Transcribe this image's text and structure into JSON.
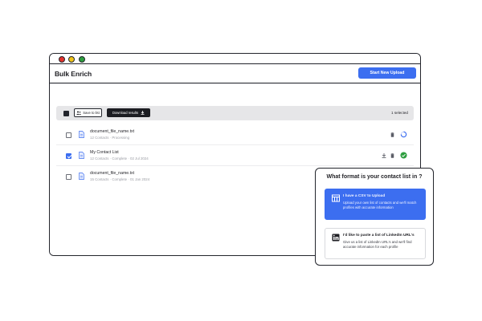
{
  "window": {
    "controls": [
      "close",
      "minimize",
      "maximize"
    ]
  },
  "app": {
    "title": "Bulk Enrich",
    "new_upload_label": "Start New Upload",
    "accent": "#3c6ef0"
  },
  "toolbar": {
    "save_label": "Save to list",
    "download_label": "Download results",
    "selected_text": "1 selected"
  },
  "files": [
    {
      "name": "document_file_name.txt",
      "meta": "12 Contacts  ·  Processing",
      "checked": false,
      "status": "processing"
    },
    {
      "name": "My Contact List",
      "meta": "12 Contacts  ·  Complete  ·  02 Jul 2024",
      "checked": true,
      "status": "complete"
    },
    {
      "name": "document_file_name.txt",
      "meta": "15 Contacts  ·  Complete  ·  01 Jan 2024",
      "checked": false,
      "status": "complete"
    }
  ],
  "popup": {
    "title": "What format is your contact list in ?",
    "options": [
      {
        "title": "I have a CSV to Upload",
        "desc": "Upload your own list of contacts and we'll match profiles with accurate information",
        "icon": "table-icon"
      },
      {
        "title": "I'd like to paste a list of LinkedIn URL's",
        "desc": "Give us a list of LinkedIn URL's and we'll find accurate information for each profile",
        "icon": "linkedin-icon"
      }
    ]
  }
}
